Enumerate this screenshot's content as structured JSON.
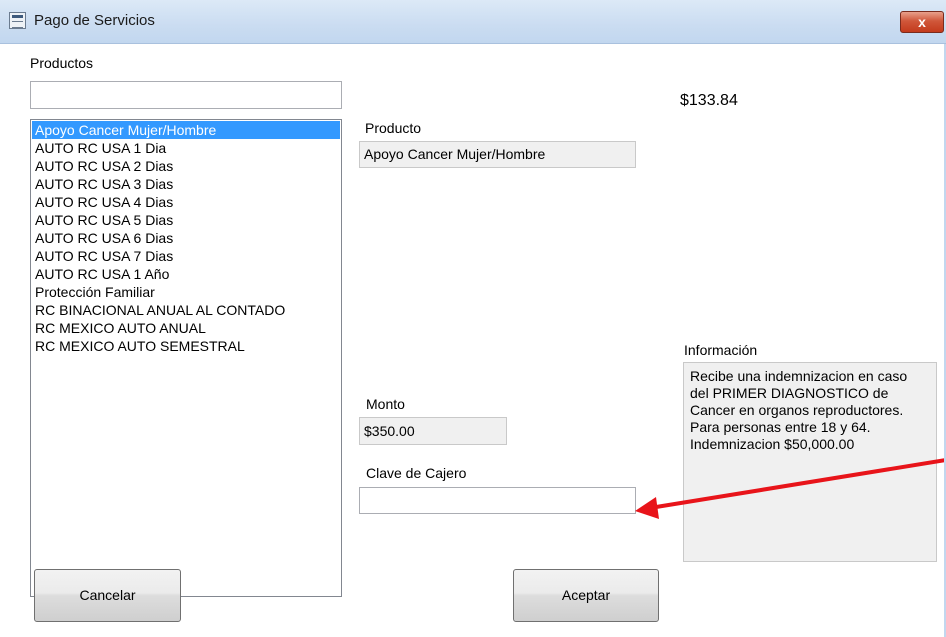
{
  "window": {
    "title": "Pago de Servicios",
    "close_label": "x"
  },
  "products": {
    "label": "Productos",
    "search_value": "",
    "items": [
      "Apoyo Cancer Mujer/Hombre",
      "AUTO RC USA 1 Dia",
      "AUTO RC USA 2 Dias",
      "AUTO RC USA 3 Dias",
      "AUTO RC USA 4 Dias",
      "AUTO RC USA 5 Dias",
      "AUTO RC USA 6 Dias",
      "AUTO RC USA 7 Dias",
      "AUTO RC USA 1 Año",
      "Protección Familiar",
      "RC BINACIONAL ANUAL AL CONTADO",
      "RC MEXICO AUTO ANUAL",
      "RC MEXICO AUTO SEMESTRAL"
    ],
    "selected_index": 0
  },
  "balance": "$133.84",
  "producto": {
    "label": "Producto",
    "value": "Apoyo Cancer Mujer/Hombre"
  },
  "monto": {
    "label": "Monto",
    "value": "$350.00"
  },
  "clave": {
    "label": "Clave de Cajero",
    "value": ""
  },
  "informacion": {
    "label": "Información",
    "lines": [
      "Recibe una indemnizacion en caso",
      "del PRIMER DIAGNOSTICO de",
      "Cancer en organos reproductores.",
      "Para personas entre 18 y 64.",
      "Indemnizacion  $50,000.00"
    ]
  },
  "buttons": {
    "cancel": "Cancelar",
    "accept": "Aceptar"
  },
  "annotation": {
    "arrow_color": "#e8141a"
  }
}
